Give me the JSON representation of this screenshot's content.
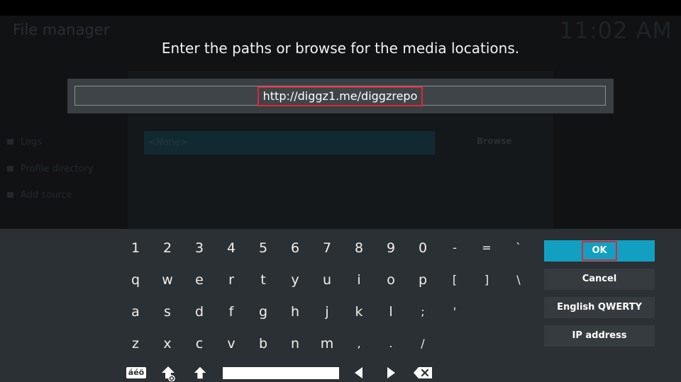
{
  "background": {
    "title": "File manager",
    "clock": "11:02 AM",
    "none_field": "<None>",
    "browse_label": "Browse",
    "sidebar_items": [
      "Logs",
      "Profile directory",
      "Add source"
    ]
  },
  "dialog": {
    "prompt": "Enter the paths or browse for the media locations.",
    "path_value": "http://diggz1.me/diggzrepo"
  },
  "keyboard": {
    "rows": [
      [
        "1",
        "2",
        "3",
        "4",
        "5",
        "6",
        "7",
        "8",
        "9",
        "0",
        "-",
        "=",
        "`"
      ],
      [
        "q",
        "w",
        "e",
        "r",
        "t",
        "y",
        "u",
        "i",
        "o",
        "p",
        "[",
        "]",
        "\\"
      ],
      [
        "a",
        "s",
        "d",
        "f",
        "g",
        "h",
        "j",
        "k",
        "l",
        ";",
        "'"
      ],
      [
        "z",
        "x",
        "c",
        "v",
        "b",
        "n",
        "m",
        ",",
        ".",
        "/"
      ]
    ],
    "accent_label": "áéö",
    "actions": {
      "ok": "OK",
      "cancel": "Cancel",
      "layout": "English QWERTY",
      "ip_address": "IP address"
    }
  },
  "colors": {
    "accent": "#12a0c2",
    "highlight_border": "#e0263a",
    "keyboard_bg": "#2b3034"
  }
}
